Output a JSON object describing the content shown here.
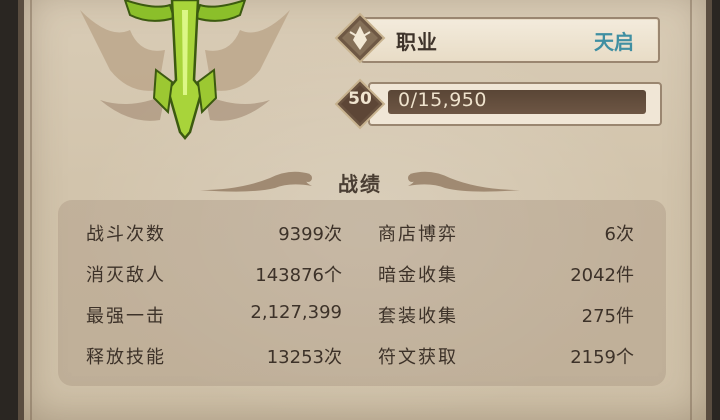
{
  "profile": {
    "class_label": "职业",
    "class_value": "天启",
    "level": "50",
    "exp_text": "0/15,950",
    "exp_fraction": 0
  },
  "stats": {
    "title": "战绩",
    "left": [
      {
        "label": "战斗次数",
        "value": "9399次"
      },
      {
        "label": "消灭敌人",
        "value": "143876个"
      },
      {
        "label": "最强一击",
        "value": "2,127,399"
      },
      {
        "label": "释放技能",
        "value": "13253次"
      }
    ],
    "right": [
      {
        "label": "商店博弈",
        "value": "6次"
      },
      {
        "label": "暗金收集",
        "value": "2042件"
      },
      {
        "label": "套装收集",
        "value": "275件"
      },
      {
        "label": "符文获取",
        "value": "2159个"
      }
    ]
  },
  "colors": {
    "class_value": "#3f8fa2",
    "text": "#3d3229",
    "parchment": "#d4c6ae"
  },
  "icons": [
    "class-emblem-icon",
    "class-diamond-icon",
    "level-diamond-icon",
    "ornament-wing-icon"
  ]
}
